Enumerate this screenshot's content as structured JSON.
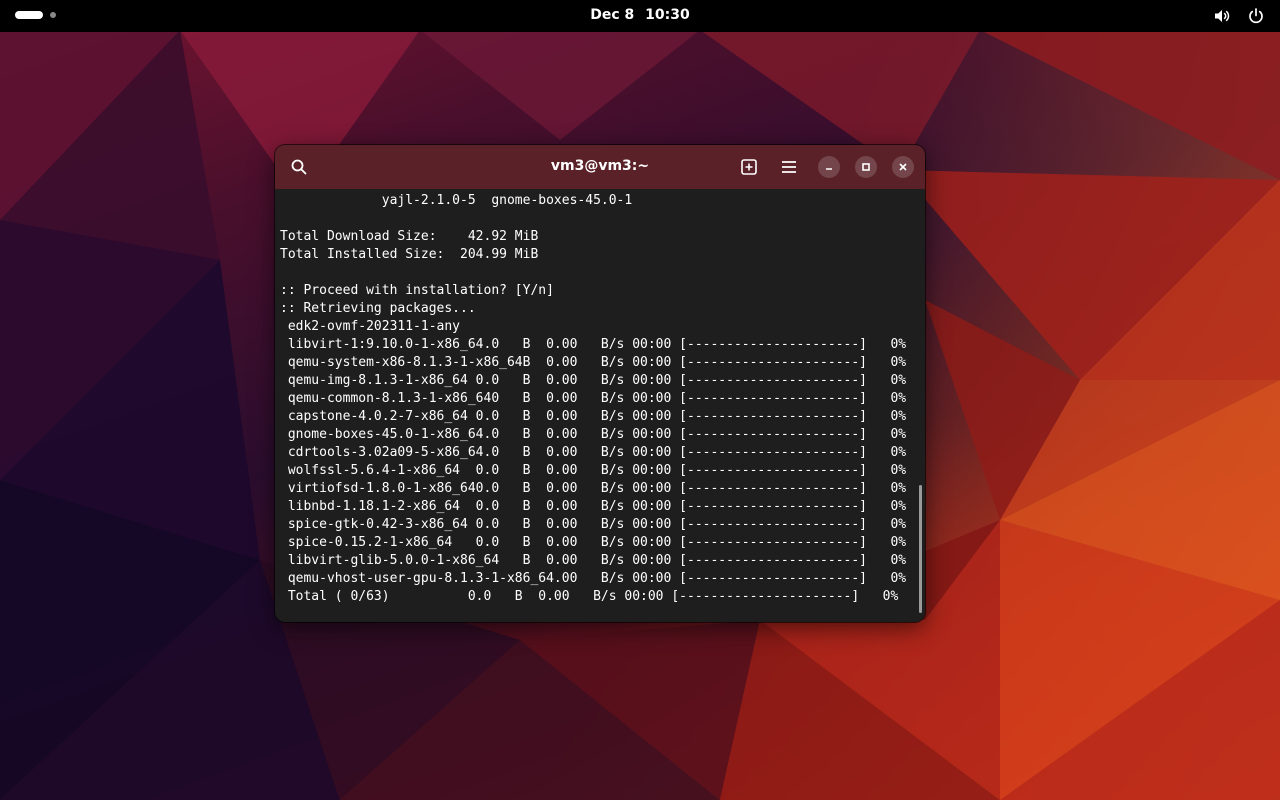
{
  "topbar": {
    "date": "Dec 8",
    "time": "10:30"
  },
  "window": {
    "title": "vm3@vm3:~"
  },
  "terminal": {
    "lines": [
      "             yajl-2.1.0-5  gnome-boxes-45.0-1",
      "",
      "Total Download Size:    42.92 MiB",
      "Total Installed Size:  204.99 MiB",
      "",
      ":: Proceed with installation? [Y/n]",
      ":: Retrieving packages...",
      " edk2-ovmf-202311-1-any",
      " libvirt-1:9.10.0-1-x86_64.0   B  0.00   B/s 00:00 [----------------------]   0%",
      " qemu-system-x86-8.1.3-1-x86_64B  0.00   B/s 00:00 [----------------------]   0%",
      " qemu-img-8.1.3-1-x86_64 0.0   B  0.00   B/s 00:00 [----------------------]   0%",
      " qemu-common-8.1.3-1-x86_640   B  0.00   B/s 00:00 [----------------------]   0%",
      " capstone-4.0.2-7-x86_64 0.0   B  0.00   B/s 00:00 [----------------------]   0%",
      " gnome-boxes-45.0-1-x86_64.0   B  0.00   B/s 00:00 [----------------------]   0%",
      " cdrtools-3.02a09-5-x86_64.0   B  0.00   B/s 00:00 [----------------------]   0%",
      " wolfssl-5.6.4-1-x86_64  0.0   B  0.00   B/s 00:00 [----------------------]   0%",
      " virtiofsd-1.8.0-1-x86_640.0   B  0.00   B/s 00:00 [----------------------]   0%",
      " libnbd-1.18.1-2-x86_64  0.0   B  0.00   B/s 00:00 [----------------------]   0%",
      " spice-gtk-0.42-3-x86_64 0.0   B  0.00   B/s 00:00 [----------------------]   0%",
      " spice-0.15.2-1-x86_64   0.0   B  0.00   B/s 00:00 [----------------------]   0%",
      " libvirt-glib-5.0.0-1-x86_64   B  0.00   B/s 00:00 [----------------------]   0%",
      " qemu-vhost-user-gpu-8.1.3-1-x86_64.00   B/s 00:00 [----------------------]   0%",
      " Total ( 0/63)          0.0   B  0.00   B/s 00:00 [----------------------]   0%"
    ]
  },
  "icons": {
    "activities": "activities-indicator-icon",
    "volume": "volume-icon",
    "power": "power-icon",
    "search": "search-icon",
    "new_tab": "new-tab-icon",
    "menu": "hamburger-menu-icon",
    "minimize": "minimize-icon",
    "maximize": "maximize-icon",
    "close": "close-icon"
  },
  "colors": {
    "topbar": "#000000",
    "headerbar": "#5a2228",
    "terminal_bg": "#1e1e1e",
    "terminal_fg": "#ffffff"
  }
}
